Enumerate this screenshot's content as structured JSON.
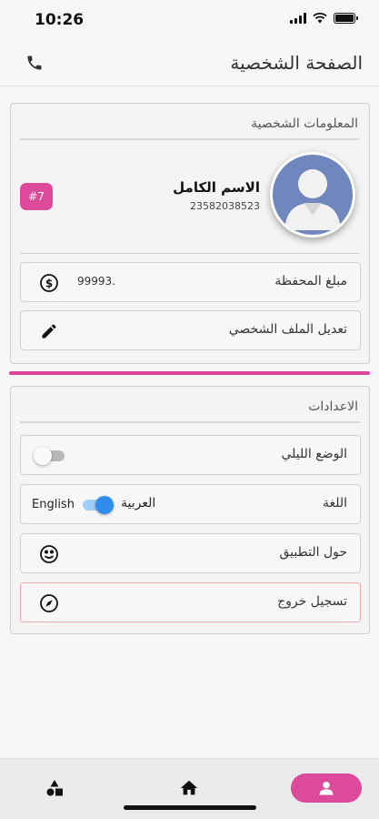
{
  "status_bar": {
    "time": "10:26"
  },
  "header": {
    "title": "الصفحة الشخصية"
  },
  "personal_info": {
    "heading": "المعلومات الشخصية",
    "name": "الاسم الكامل",
    "number": "23582038523",
    "badge": "#7",
    "wallet": {
      "label": "مبلغ المحفظة",
      "value": "99993."
    },
    "edit_profile": "تعديل الملف الشخصي"
  },
  "settings": {
    "heading": "الاعدادات",
    "night_mode": {
      "label": "الوضع الليلي",
      "enabled": false
    },
    "language": {
      "label": "اللغة",
      "option_arabic": "العربية",
      "option_english": "English",
      "selected": "English"
    },
    "about": "حول التطبيق",
    "logout": "تسجيل خروج"
  },
  "icons": {
    "call": "phone-icon",
    "wallet": "dollar-circle-icon",
    "edit": "pencil-icon",
    "about": "app-info-icon",
    "logout": "compass-icon",
    "nav_categories": "shapes-icon",
    "nav_home": "home-icon",
    "nav_profile": "person-icon"
  },
  "colors": {
    "accent": "#dd4a9b",
    "avatar_bg": "#6f86bf",
    "toggle_on": "#2f8ce8",
    "logout_border": "#f0a8a8"
  }
}
